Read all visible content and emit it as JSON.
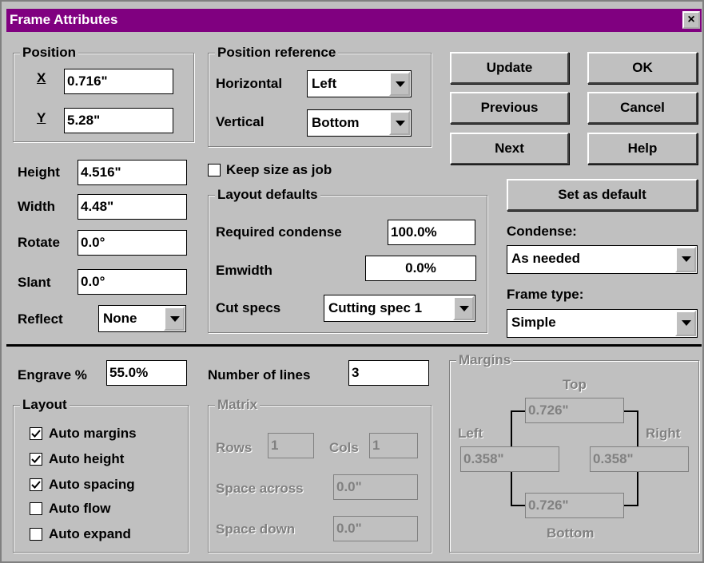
{
  "window": {
    "title": "Frame Attributes",
    "close_label": "×"
  },
  "position": {
    "title": "Position",
    "x_label": "X",
    "x_value": "0.716\"",
    "y_label": "Y",
    "y_value": "5.28\""
  },
  "position_ref": {
    "title": "Position reference",
    "horizontal_label": "Horizontal",
    "horizontal_value": "Left",
    "vertical_label": "Vertical",
    "vertical_value": "Bottom"
  },
  "buttons": {
    "update": "Update",
    "ok": "OK",
    "previous": "Previous",
    "cancel": "Cancel",
    "next": "Next",
    "help": "Help",
    "set_default": "Set as default"
  },
  "size": {
    "height_label": "Height",
    "height_value": "4.516\"",
    "width_label": "Width",
    "width_value": "4.48\"",
    "rotate_label": "Rotate",
    "rotate_value": "0.0°",
    "slant_label": "Slant",
    "slant_value": "0.0°",
    "reflect_label": "Reflect",
    "reflect_value": "None"
  },
  "keep_size": {
    "label": "Keep size as job",
    "checked": false
  },
  "layout_defaults": {
    "title": "Layout defaults",
    "required_condense_label": "Required condense",
    "required_condense_value": "100.0%",
    "emwidth_label": "Emwidth",
    "emwidth_value": "0.0%",
    "cut_specs_label": "Cut specs",
    "cut_specs_value": "Cutting spec 1"
  },
  "condense": {
    "label": "Condense:",
    "value": "As needed"
  },
  "frame_type": {
    "label": "Frame type:",
    "value": "Simple"
  },
  "engrave": {
    "label": "Engrave %",
    "value": "55.0%"
  },
  "lines": {
    "label": "Number of lines",
    "value": "3"
  },
  "layout": {
    "title": "Layout",
    "items": [
      {
        "label": "Auto margins",
        "checked": true
      },
      {
        "label": "Auto height",
        "checked": true
      },
      {
        "label": "Auto spacing",
        "checked": true
      },
      {
        "label": "Auto flow",
        "checked": false
      },
      {
        "label": "Auto expand",
        "checked": false
      }
    ]
  },
  "matrix": {
    "title": "Matrix",
    "rows_label": "Rows",
    "rows_value": "1",
    "cols_label": "Cols",
    "cols_value": "1",
    "space_across_label": "Space across",
    "space_across_value": "0.0\"",
    "space_down_label": "Space down",
    "space_down_value": "0.0\""
  },
  "margins": {
    "title": "Margins",
    "top_label": "Top",
    "top_value": "0.726\"",
    "left_label": "Left",
    "left_value": "0.358\"",
    "right_label": "Right",
    "right_value": "0.358\"",
    "bottom_label": "Bottom",
    "bottom_value": "0.726\""
  }
}
